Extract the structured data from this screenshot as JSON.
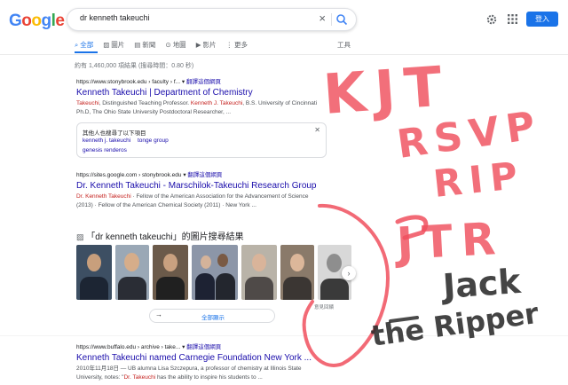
{
  "header": {
    "logo": "Google",
    "search_value": "dr kenneth takeuchi",
    "login_label": "登入"
  },
  "tabs": [
    {
      "label": "全部",
      "icon": "search-icon"
    },
    {
      "label": "圖片",
      "icon": "image-icon"
    },
    {
      "label": "新聞",
      "icon": "news-icon"
    },
    {
      "label": "地圖",
      "icon": "map-pin-icon"
    },
    {
      "label": "影片",
      "icon": "video-icon"
    },
    {
      "label": "更多",
      "icon": "more-vert-icon"
    }
  ],
  "tools_label": "工具",
  "stats": "約有 1,460,000 項結果 (搜尋時間：0.80 秒)",
  "results": [
    {
      "cite": "https://www.stonybrook.edu › faculty › f...",
      "translate": "翻譯這個網頁",
      "title": "Kenneth Takeuchi | Department of Chemistry",
      "snippet1_em": "Takeuchi",
      "snippet1": ", Distinguished Teaching Professor. ",
      "snippet1_em2": "Kenneth J. Takeuchi",
      "snippet1_tail": ", B.S. University of Cincinnati",
      "snippet2": "Ph.D, The Ohio State University Postdoctoral Researcher, ..."
    },
    {
      "cite": "https://sites.google.com › stonybrook.edu",
      "translate": "翻譯這個網頁",
      "title": "Dr. Kenneth Takeuchi - Marschilok-Takeuchi Research Group",
      "snippet1_em": "Dr. Kenneth Takeuchi",
      "snippet1": " · Fellow of the American Association for the Advancement of Science",
      "snippet2": "(2013) · Fellow of the American Chemical Society (2011) · New York ..."
    },
    {
      "cite": "https://www.buffalo.edu › archive › take...",
      "translate": "翻譯這個網頁",
      "title": "Kenneth Takeuchi named Carnegie Foundation New York ...",
      "snippet1": "2010年11月18日 — UB alumna Lisa Szczepura, a professor of chemistry at Illinois State",
      "snippet2_a": "University, notes: \"",
      "snippet2_em": "Dr. Takeuchi",
      "snippet2_b": " has the ability to inspire his students to ..."
    }
  ],
  "people_also_search": {
    "heading": "其他人也搜尋了以下項目",
    "links": [
      "kenneth j. takeuchi",
      "tonge group",
      "genesis renderos"
    ]
  },
  "image_section": {
    "heading": "「dr kenneth takeuchi」的圖片搜尋結果",
    "note": "意見回饋",
    "show_all": "全部顯示"
  },
  "handwriting": [
    "KJT",
    "RSVP",
    "RIP",
    "JTR",
    "Jack",
    "the Ripper"
  ],
  "colors": {
    "accent": "#1a73e8",
    "link": "#1a0dab",
    "ink_red": "#f0505e",
    "ink_black": "#2b2b2b"
  }
}
